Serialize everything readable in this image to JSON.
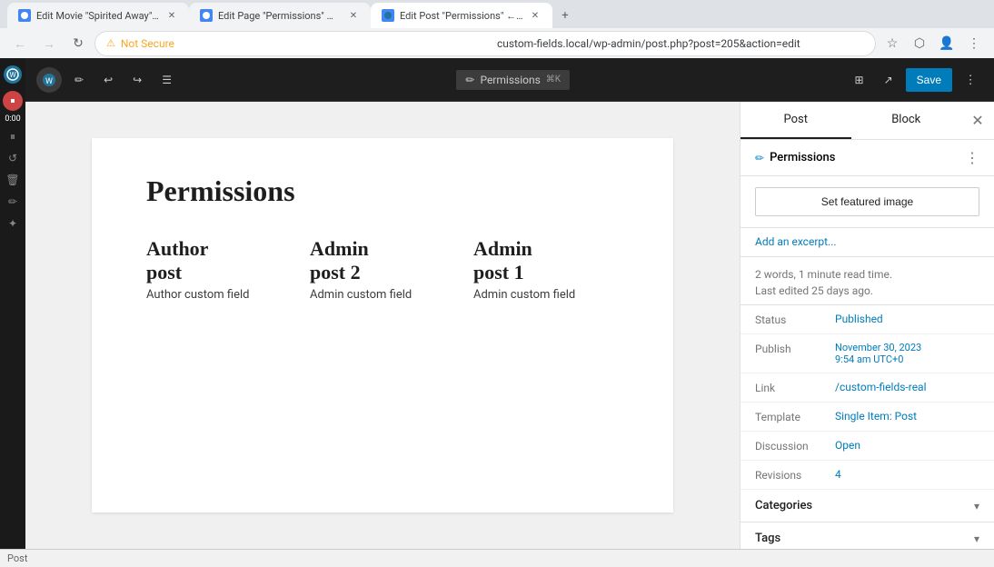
{
  "browser": {
    "tabs": [
      {
        "id": "tab1",
        "title": "Edit Movie \"Spirited Away\" ← e...",
        "favicon_color": "#21759b",
        "active": false
      },
      {
        "id": "tab2",
        "title": "Edit Page \"Permissions\" ← e...",
        "favicon_color": "#21759b",
        "active": false
      },
      {
        "id": "tab3",
        "title": "Edit Post \"Permissions\" ← e...",
        "favicon_color": "#21759b",
        "active": true
      }
    ],
    "address": "custom-fields.local/wp-admin/post.php?post=205&action=edit",
    "security_label": "Not Secure"
  },
  "wp_topbar": {
    "page_tab_icon": "✏",
    "page_tab_label": "Permissions",
    "page_tab_shortcut": "⌘K",
    "save_label": "Save",
    "undo_label": "↩",
    "redo_label": "↪"
  },
  "editor": {
    "page_title": "Permissions",
    "columns": [
      {
        "heading_line1": "Author",
        "heading_line2": "post",
        "custom_field": "Author custom field"
      },
      {
        "heading_line1": "Admin",
        "heading_line2": "post 2",
        "custom_field": "Admin custom field"
      },
      {
        "heading_line1": "Admin",
        "heading_line2": "post 1",
        "custom_field": "Admin custom field"
      }
    ]
  },
  "sidebar": {
    "tab_post": "Post",
    "tab_block": "Block",
    "permissions_section_label": "Permissions",
    "featured_image_btn": "Set featured image",
    "add_excerpt_link": "Add an excerpt...",
    "word_count_text": "2 words, 1 minute read time.",
    "last_edited_text": "Last edited 25 days ago.",
    "rows": [
      {
        "label": "Status",
        "value": "Published",
        "type": "link"
      },
      {
        "label": "Publish",
        "value": "November 30, 2023\n9:54 am UTC+0",
        "type": "link"
      },
      {
        "label": "Link",
        "value": "/custom-fields-real",
        "type": "link"
      },
      {
        "label": "Template",
        "value": "Single Item: Post",
        "type": "link"
      },
      {
        "label": "Discussion",
        "value": "Open",
        "type": "link"
      },
      {
        "label": "Revisions",
        "value": "4",
        "type": "link"
      }
    ],
    "categories_label": "Categories",
    "tags_label": "Tags"
  },
  "recording_bar": {
    "time": "0:00"
  },
  "status_bar": {
    "text": "Post"
  }
}
